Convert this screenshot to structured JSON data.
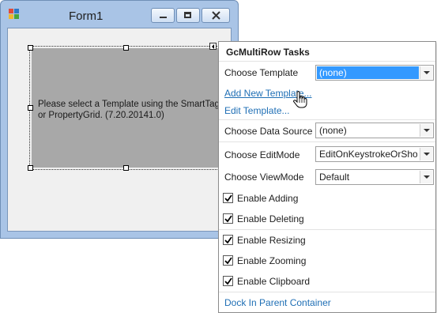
{
  "window": {
    "title": "Form1",
    "minimize_icon": "minimize-icon",
    "maximize_icon": "maximize-icon",
    "close_icon": "close-icon"
  },
  "grid": {
    "message": "Please select a Template using the SmartTag or PropertyGrid. (7.20.20141.0)"
  },
  "tasks": {
    "header": "GcMultiRow Tasks",
    "choose_template": {
      "label": "Choose Template",
      "value": "(none)"
    },
    "add_new_template": "Add New Template...",
    "edit_template": "Edit Template...",
    "choose_data_source": {
      "label": "Choose Data Source",
      "value": "(none)"
    },
    "choose_edit_mode": {
      "label": "Choose EditMode",
      "value": "EditOnKeystrokeOrShortcutKey"
    },
    "choose_view_mode": {
      "label": "Choose ViewMode",
      "value": "Default"
    },
    "checkboxes": [
      {
        "label": "Enable Adding",
        "checked": true
      },
      {
        "label": "Enable Deleting",
        "checked": true
      },
      {
        "label": "Enable Resizing",
        "checked": true
      },
      {
        "label": "Enable Zooming",
        "checked": true
      },
      {
        "label": "Enable Clipboard",
        "checked": true
      }
    ],
    "dock_link": "Dock In Parent Container"
  },
  "colors": {
    "title_bar": "#a9c4e6",
    "grid_background": "#a8a8a8",
    "selection": "#3399ff",
    "link": "#1f6fb5"
  }
}
